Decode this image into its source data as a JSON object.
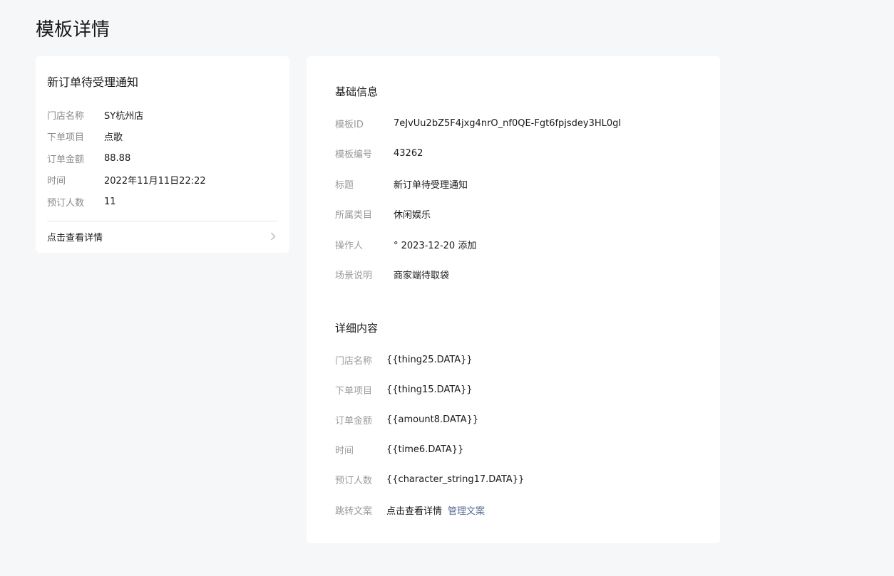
{
  "page": {
    "title": "模板详情"
  },
  "preview": {
    "title": "新订单待受理通知",
    "rows": [
      {
        "key": "门店名称",
        "value": "SY杭州店"
      },
      {
        "key": "下单项目",
        "value": "点歌"
      },
      {
        "key": "订单金额",
        "value": "88.88"
      },
      {
        "key": "时间",
        "value": "2022年11月11日22:22"
      },
      {
        "key": "预订人数",
        "value": "11"
      }
    ],
    "link_label": "点击查看详情",
    "link_icon": "chevron-right-icon"
  },
  "basic_info": {
    "title": "基础信息",
    "rows": [
      {
        "key": "模板ID",
        "value": "7eJvUu2bZ5F4jxg4nrO_nf0QE-Fgt6fpjsdey3HL0gI"
      },
      {
        "key": "模板编号",
        "value": "43262"
      },
      {
        "key": "标题",
        "value": "新订单待受理通知"
      },
      {
        "key": "所属类目",
        "value": "休闲娱乐"
      },
      {
        "key": "操作人",
        "value": "° 2023-12-20 添加"
      },
      {
        "key": "场景说明",
        "value": "商家端待取袋"
      }
    ]
  },
  "detail_content": {
    "title": "详细内容",
    "rows": [
      {
        "key": "门店名称",
        "value": "{{thing25.DATA}}"
      },
      {
        "key": "下单项目",
        "value": "{{thing15.DATA}}"
      },
      {
        "key": "订单金额",
        "value": "{{amount8.DATA}}"
      },
      {
        "key": "时间",
        "value": "{{time6.DATA}}"
      },
      {
        "key": "预订人数",
        "value": "{{character_string17.DATA}}"
      }
    ],
    "jump_row": {
      "key": "跳转文案",
      "value": "点击查看详情",
      "manage_label": "管理文案"
    }
  },
  "colors": {
    "background": "#f6f7f8",
    "card": "#ffffff",
    "link": "#576b95",
    "label": "#9a9a9a"
  }
}
